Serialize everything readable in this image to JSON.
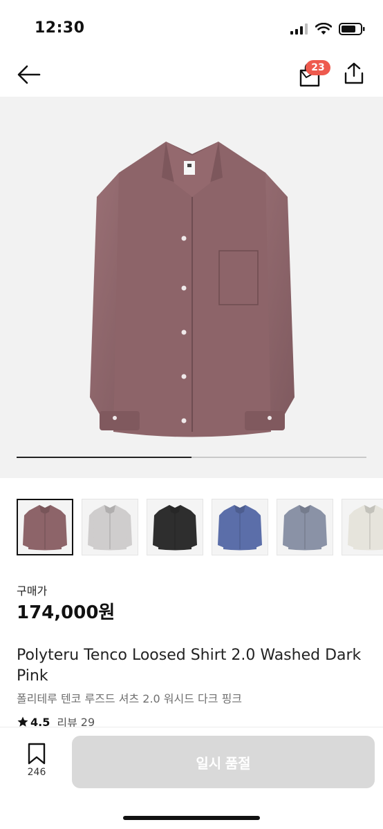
{
  "status": {
    "time": "12:30"
  },
  "nav": {
    "back_icon": "arrow-left-icon",
    "bag_icon": "shopping-bag-icon",
    "bag_badge": "23",
    "share_icon": "share-icon"
  },
  "colors": {
    "badge": "#ee5a4e",
    "hero_background": "#f2f2f2",
    "soldout_button": "#d9d9d9",
    "shirt_colors": [
      "#8d6469",
      "#cfcdcd",
      "#2e2e2e",
      "#5b6ea9",
      "#8a92a6",
      "#e6e4dc"
    ]
  },
  "gallery": {
    "progress": 0.5
  },
  "thumbnails": [
    {
      "name": "dark-pink-shirt"
    },
    {
      "name": "light-grey-shirt"
    },
    {
      "name": "black-shirt"
    },
    {
      "name": "blue-shirt"
    },
    {
      "name": "grey-blue-shirt"
    },
    {
      "name": "ivory-shirt"
    }
  ],
  "product": {
    "price_label": "구매가",
    "price": "174,000원",
    "title_en": "Polyteru Tenco Loosed Shirt 2.0 Washed Dark Pink",
    "title_ko": "폴리테루 텐코 루즈드 셔츠 2.0 워시드 다크 핑크",
    "rating": "4.5",
    "review_label": "리뷰",
    "review_count": "29"
  },
  "bottom": {
    "save_icon": "bookmark-icon",
    "save_count": "246",
    "soldout_label": "일시 품절"
  }
}
